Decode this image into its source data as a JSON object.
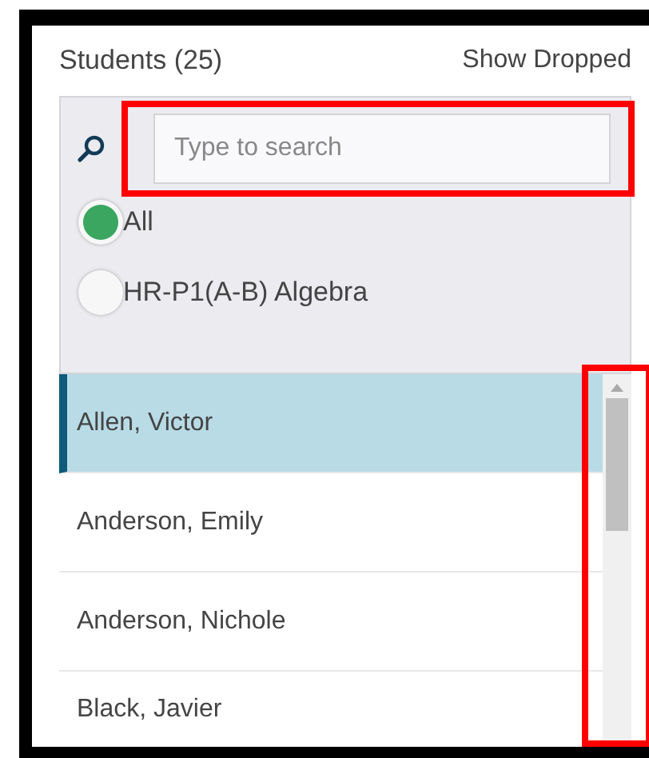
{
  "header": {
    "title": "Students (25)",
    "action": "Show Dropped"
  },
  "search": {
    "placeholder": "Type to search",
    "highlighted": true
  },
  "filters": [
    {
      "label": "All",
      "selected": true
    },
    {
      "label": "HR-P1(A-B) Algebra",
      "selected": false
    }
  ],
  "students": [
    {
      "name": "Allen, Victor",
      "selected": true
    },
    {
      "name": "Anderson, Emily",
      "selected": false
    },
    {
      "name": "Anderson, Nichole",
      "selected": false
    },
    {
      "name": "Black, Javier",
      "selected": false
    }
  ],
  "scrollbar": {
    "highlighted": true
  }
}
